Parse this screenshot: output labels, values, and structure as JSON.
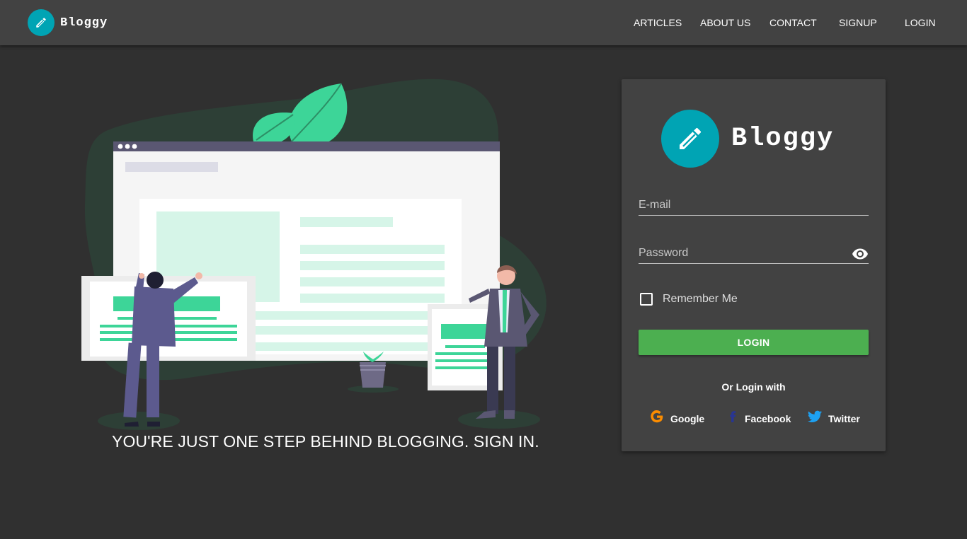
{
  "app": {
    "name": "Bloggy"
  },
  "nav": {
    "items": [
      {
        "label": "ARTICLES"
      },
      {
        "label": "ABOUT US"
      },
      {
        "label": "CONTACT"
      },
      {
        "label": "SIGNUP"
      },
      {
        "label": "LOGIN"
      }
    ]
  },
  "hero": {
    "tagline": "YOU'RE JUST ONE STEP BEHIND BLOGGING. SIGN IN."
  },
  "login_form": {
    "brand_name": "Bloggy",
    "email_placeholder": "E-mail",
    "email_value": "",
    "password_placeholder": "Password",
    "password_value": "",
    "remember_label": "Remember Me",
    "remember_checked": false,
    "submit_label": "LOGIN",
    "or_text": "Or Login with",
    "social": [
      {
        "label": "Google",
        "icon": "google-icon"
      },
      {
        "label": "Facebook",
        "icon": "facebook-icon"
      },
      {
        "label": "Twitter",
        "icon": "twitter-icon"
      }
    ]
  },
  "colors": {
    "background": "#303030",
    "toolbar": "#424242",
    "card": "#424242",
    "brand_accent": "#00a4b4",
    "login_button": "#4caf50",
    "illustration_green": "#3dd598",
    "google": "#fb8c00",
    "facebook": "#283593",
    "twitter": "#1da1f2"
  }
}
